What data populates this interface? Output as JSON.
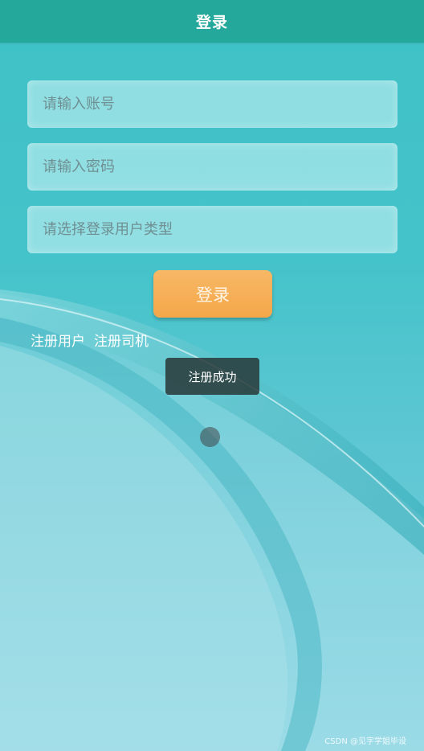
{
  "header": {
    "title": "登录"
  },
  "form": {
    "account_placeholder": "请输入账号",
    "password_placeholder": "请输入密码",
    "usertype_placeholder": "请选择登录用户类型",
    "login_label": "登录"
  },
  "links": {
    "register_user": "注册用户",
    "register_driver": "注册司机"
  },
  "toast": {
    "message": "注册成功"
  },
  "watermark": "CSDN @见字学姐毕设",
  "colors": {
    "header": "#23a89b",
    "login_button": "#f4a74a",
    "background": "#45c3ca"
  }
}
